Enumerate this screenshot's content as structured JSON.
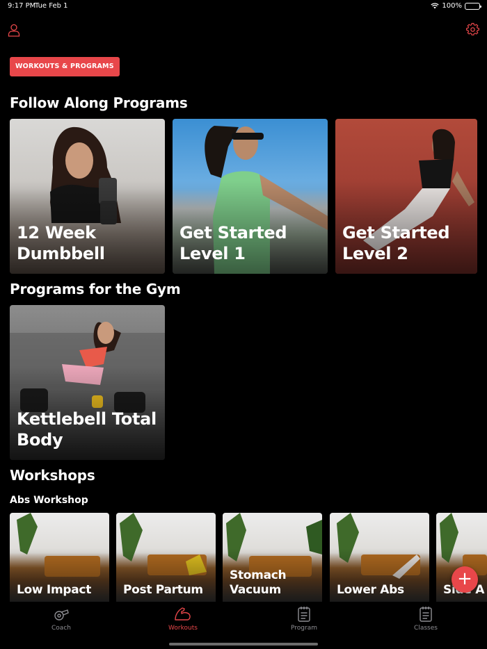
{
  "status_bar": {
    "time": "9:17 PM",
    "date": "Tue Feb 1",
    "battery": "100%",
    "battery_level": 1.0
  },
  "header": {
    "profile_icon": "person-icon",
    "settings_icon": "gear-icon",
    "pill_label": "WORKOUTS & PROGRAMS"
  },
  "sections": {
    "follow_along": {
      "title": "Follow Along Programs",
      "cards": [
        {
          "label": "12 Week Dumbbell"
        },
        {
          "label": "Get Started Level 1"
        },
        {
          "label": "Get Started Level 2"
        }
      ]
    },
    "gym": {
      "title": "Programs for the Gym",
      "cards": [
        {
          "label": "Kettlebell Total Body"
        }
      ]
    },
    "workshops": {
      "title": "Workshops",
      "subtitle": "Abs Workshop",
      "cards": [
        {
          "label": "Low Impact"
        },
        {
          "label": "Post Partum"
        },
        {
          "label": "Stomach Vacuum"
        },
        {
          "label": "Lower Abs"
        },
        {
          "label": "Side A"
        }
      ]
    }
  },
  "fab": {
    "label": "+"
  },
  "tabbar": {
    "tabs": [
      {
        "label": "Coach",
        "icon": "whistle-icon"
      },
      {
        "label": "Workouts",
        "icon": "flexed-arm-icon",
        "active": true
      },
      {
        "label": "Program",
        "icon": "notepad-icon"
      },
      {
        "label": "Classes",
        "icon": "notepad-icon"
      }
    ]
  },
  "colors": {
    "accent": "#e8474a",
    "background": "#000000",
    "inactive": "#8e8e93"
  }
}
